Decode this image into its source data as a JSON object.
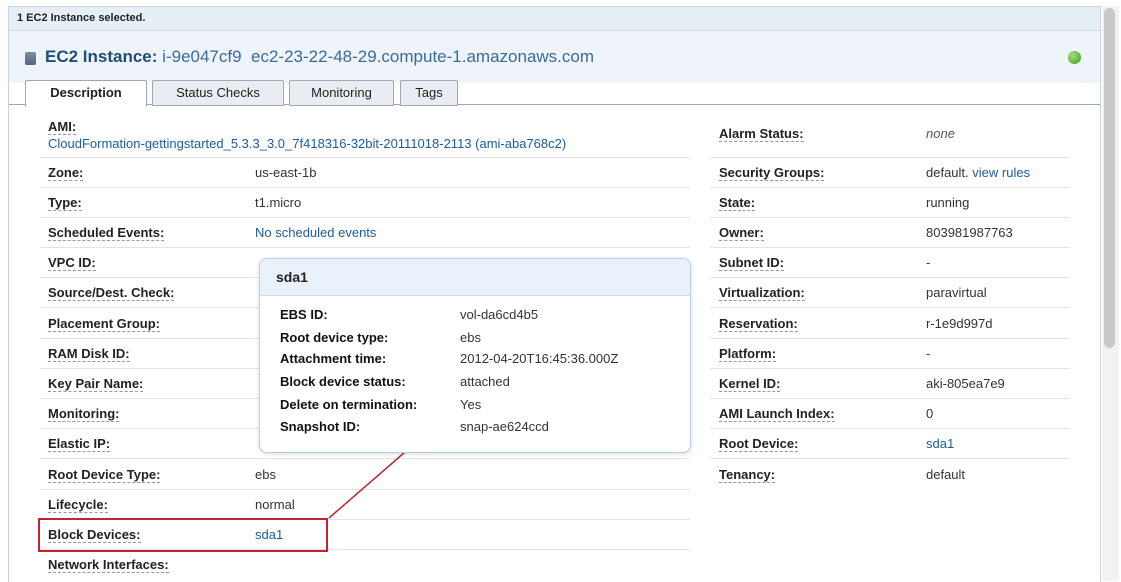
{
  "topbar": {
    "selection_text": "1 EC2 Instance selected."
  },
  "header": {
    "label": "EC2 Instance:",
    "instance_id": "i-9e047cf9",
    "public_dns": "ec2-23-22-48-29.compute-1.amazonaws.com",
    "status_color": "#3e9b1f"
  },
  "tabs": [
    {
      "label": "Description",
      "active": true
    },
    {
      "label": "Status Checks",
      "active": false
    },
    {
      "label": "Monitoring",
      "active": false
    },
    {
      "label": "Tags",
      "active": false
    }
  ],
  "left": {
    "ami_label": "AMI:",
    "ami_value": "CloudFormation-gettingstarted_5.3.3_3.0_7f418316-32bit-20111018-2113 (ami-aba768c2)",
    "rows": [
      {
        "label": "Zone:",
        "value": "us-east-1b"
      },
      {
        "label": "Type:",
        "value": "t1.micro"
      },
      {
        "label": "Scheduled Events:",
        "value": "No scheduled events"
      },
      {
        "label": "VPC ID:",
        "value": ""
      },
      {
        "label": "Source/Dest. Check:",
        "value": ""
      },
      {
        "label": "Placement Group:",
        "value": ""
      },
      {
        "label": "RAM Disk ID:",
        "value": ""
      },
      {
        "label": "Key Pair Name:",
        "value": ""
      },
      {
        "label": "Monitoring:",
        "value": ""
      },
      {
        "label": "Elastic IP:",
        "value": ""
      },
      {
        "label": "Root Device Type:",
        "value": "ebs"
      },
      {
        "label": "Lifecycle:",
        "value": "normal"
      },
      {
        "label": "Block Devices:",
        "value": "sda1"
      },
      {
        "label": "Network Interfaces:",
        "value": ""
      }
    ]
  },
  "right": {
    "rows": [
      {
        "label": "Alarm Status:",
        "value": "none"
      },
      {
        "label": "Security Groups:",
        "value": "default.",
        "link": "view rules"
      },
      {
        "label": "State:",
        "value": "running"
      },
      {
        "label": "Owner:",
        "value": "803981987763"
      },
      {
        "label": "Subnet ID:",
        "value": "-"
      },
      {
        "label": "Virtualization:",
        "value": "paravirtual"
      },
      {
        "label": "Reservation:",
        "value": "r-1e9d997d"
      },
      {
        "label": "Platform:",
        "value": "-"
      },
      {
        "label": "Kernel ID:",
        "value": "aki-805ea7e9"
      },
      {
        "label": "AMI Launch Index:",
        "value": "0"
      },
      {
        "label": "Root Device:",
        "value": "sda1"
      },
      {
        "label": "Tenancy:",
        "value": "default"
      }
    ]
  },
  "popup": {
    "title": "sda1",
    "rows": [
      {
        "label": "EBS ID:",
        "value": "vol-da6cd4b5"
      },
      {
        "label": "Root device type:",
        "value": "ebs"
      },
      {
        "label": "Attachment time:",
        "value": "2012-04-20T16:45:36.000Z"
      },
      {
        "label": "Block device status:",
        "value": "attached"
      },
      {
        "label": "Delete on termination:",
        "value": "Yes"
      },
      {
        "label": "Snapshot ID:",
        "value": "snap-ae624ccd"
      }
    ]
  },
  "colors": {
    "link": "#1d5c9b",
    "highlight": "#c0262d",
    "header_bg": "#eef4fa"
  }
}
